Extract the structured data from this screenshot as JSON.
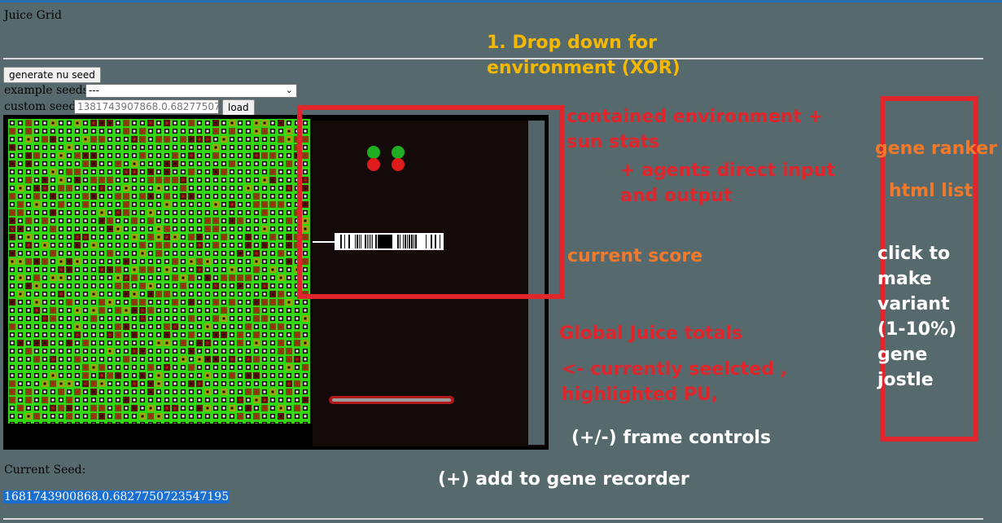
{
  "page": {
    "title": "Juice Grid"
  },
  "controls": {
    "generate_label": "generate nu seed",
    "example_seeds_label": "example seeds:",
    "example_seeds_selected": "---",
    "custom_seed_label": "custom seed:",
    "custom_seed_value": "1381743907868.0.68277507",
    "load_label": "load"
  },
  "annotations": {
    "dropdown": "1. Drop down for environment (XOR)",
    "contained_env": "contained environment + sun stats",
    "agents_io": "+ agents direct input and output",
    "current_score": "current score",
    "global_juice": "Global Juice totals",
    "selected_pu": "<- currently seelcted , highlighted PU,",
    "frame_controls": "(+/-) frame controls",
    "gene_recorder": "(+) add to gene recorder",
    "gene_ranker": "gene ranker",
    "html_list": "html list",
    "variant": "click to make variant (1-10%) gene jostle"
  },
  "footer": {
    "current_seed_label": "Current Seed:",
    "current_seed_value": "1681743900868.0.6827750723547195"
  },
  "colors": {
    "background": "#566a6e",
    "annotation_red": "#e0262c",
    "annotation_orange": "#f0792c",
    "annotation_yellow": "#f5b800",
    "grid_green": "#32d512"
  },
  "icons": {
    "dropdown": "chevron-down-icon"
  }
}
